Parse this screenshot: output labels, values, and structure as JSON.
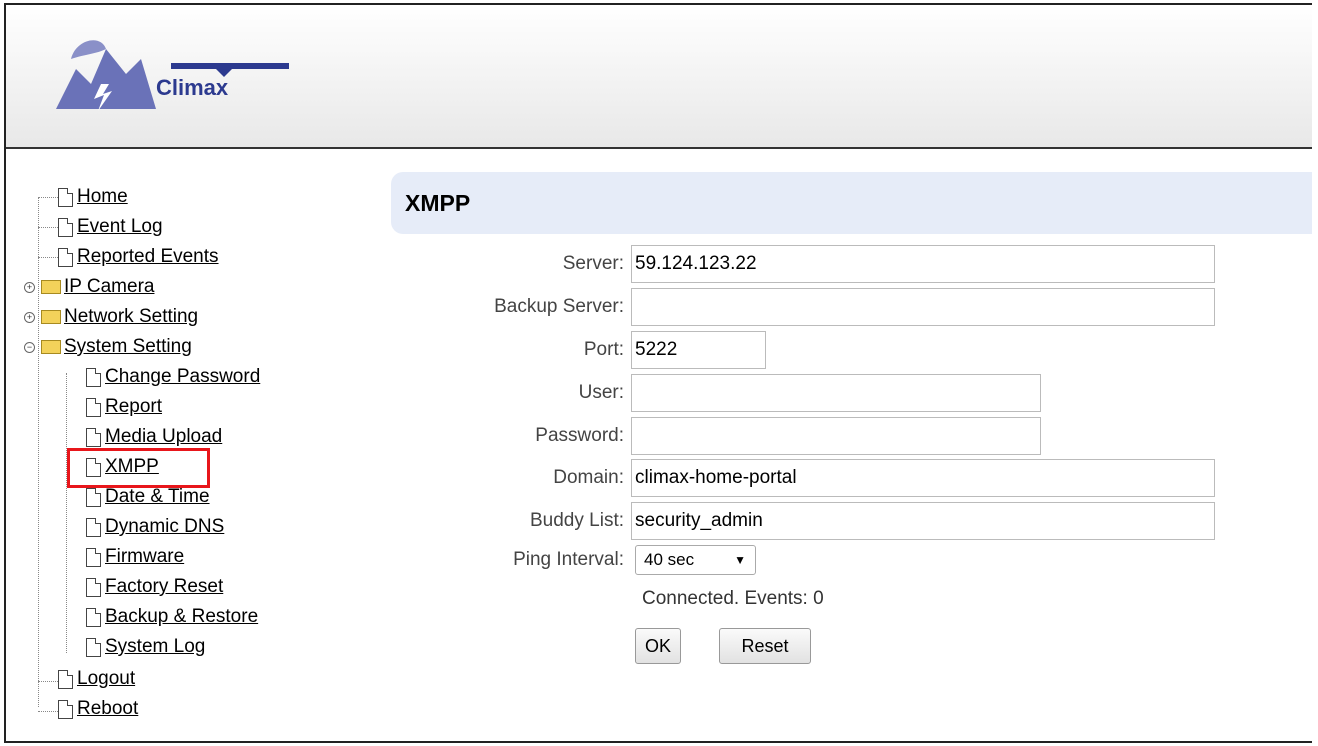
{
  "brand": {
    "name": "Climax"
  },
  "sidebar": {
    "items": [
      {
        "label": "Home"
      },
      {
        "label": "Event Log"
      },
      {
        "label": "Reported Events"
      },
      {
        "label": "IP Camera"
      },
      {
        "label": "Network Setting"
      },
      {
        "label": "System Setting"
      },
      {
        "label": "Change Password"
      },
      {
        "label": "Report"
      },
      {
        "label": "Media Upload"
      },
      {
        "label": "XMPP"
      },
      {
        "label": "Date & Time"
      },
      {
        "label": "Dynamic DNS"
      },
      {
        "label": "Firmware"
      },
      {
        "label": "Factory Reset"
      },
      {
        "label": "Backup & Restore"
      },
      {
        "label": "System Log"
      },
      {
        "label": "Logout"
      },
      {
        "label": "Reboot"
      }
    ],
    "toggle_collapsed": "+",
    "toggle_expanded": "−"
  },
  "main": {
    "title": "XMPP",
    "fields": {
      "server": {
        "label": "Server:",
        "value": "59.124.123.22"
      },
      "backup_server": {
        "label": "Backup Server:",
        "value": ""
      },
      "port": {
        "label": "Port:",
        "value": "5222"
      },
      "user": {
        "label": "User:",
        "value": ""
      },
      "password": {
        "label": "Password:",
        "value": ""
      },
      "domain": {
        "label": "Domain:",
        "value": "climax-home-portal"
      },
      "buddy_list": {
        "label": "Buddy List:",
        "value": "security_admin"
      },
      "ping_interval": {
        "label": "Ping Interval:",
        "value": "40 sec"
      }
    },
    "status": "Connected. Events: 0",
    "ok_label": "OK",
    "reset_label": "Reset"
  }
}
